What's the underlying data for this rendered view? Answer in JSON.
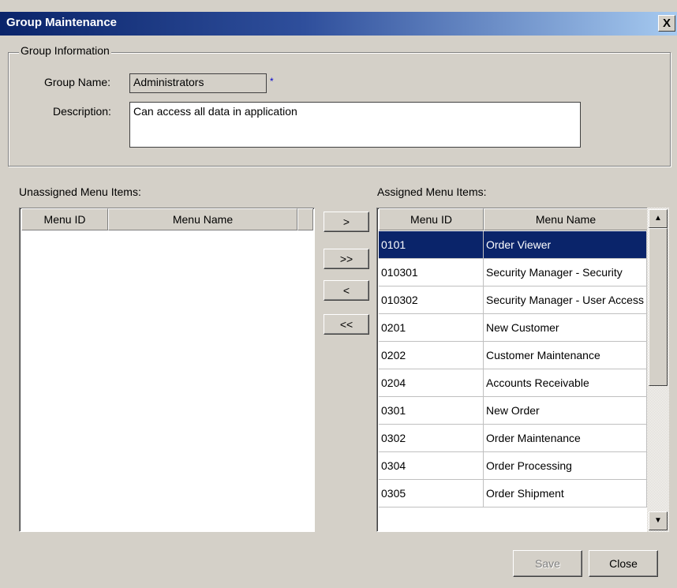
{
  "window": {
    "title": "Group Maintenance",
    "close_glyph": "X",
    "close_icon": "close-icon"
  },
  "group_info": {
    "legend": "Group Information",
    "name_label": "Group Name:",
    "name_value": "Administrators",
    "required_marker": "*",
    "description_label": "Description:",
    "description_value": "Can access all data in application"
  },
  "unassigned": {
    "label": "Unassigned Menu Items:",
    "columns": [
      "Menu ID",
      "Menu Name"
    ],
    "rows": []
  },
  "transfer_buttons": {
    "add": ">",
    "add_all": ">>",
    "remove": "<",
    "remove_all": "<<"
  },
  "assigned": {
    "label": "Assigned Menu Items:",
    "columns": [
      "Menu ID",
      "Menu Name"
    ],
    "selected_index": 0,
    "rows": [
      {
        "id": "0101",
        "name": "Order Viewer"
      },
      {
        "id": "010301",
        "name": "Security Manager - Security"
      },
      {
        "id": "010302",
        "name": "Security Manager - User Access"
      },
      {
        "id": "0201",
        "name": "New Customer"
      },
      {
        "id": "0202",
        "name": "Customer Maintenance"
      },
      {
        "id": "0204",
        "name": "Accounts Receivable"
      },
      {
        "id": "0301",
        "name": "New Order"
      },
      {
        "id": "0302",
        "name": "Order Maintenance"
      },
      {
        "id": "0304",
        "name": "Order Processing"
      },
      {
        "id": "0305",
        "name": "Order Shipment"
      }
    ]
  },
  "scrollbar": {
    "up_glyph": "▲",
    "down_glyph": "▼"
  },
  "footer": {
    "save_label": "Save",
    "save_enabled": false,
    "close_label": "Close"
  },
  "colors": {
    "titlebar": "#0a246a",
    "selection": "#0a246a",
    "face": "#d4d0c8"
  }
}
